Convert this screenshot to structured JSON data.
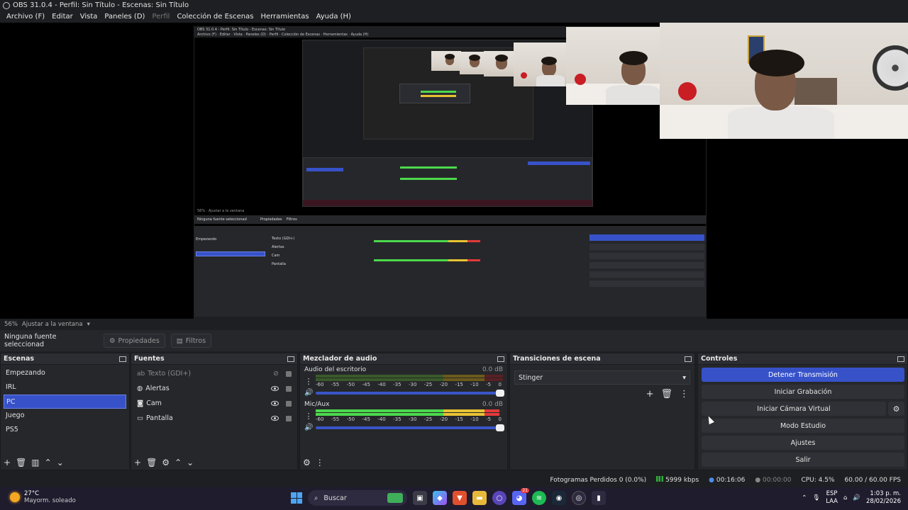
{
  "window": {
    "title": "OBS 31.0.4 - Perfil: Sin Título - Escenas: Sin Título"
  },
  "menu": {
    "items": [
      "Archivo (F)",
      "Editar",
      "Vista",
      "Paneles (D)",
      "Perfil",
      "Colección de Escenas",
      "Herramientas",
      "Ayuda (H)"
    ],
    "disabled_index": 4
  },
  "preview": {
    "zoom_label": "56%",
    "fit_label": "Ajustar a la ventana",
    "nested_title": "OBS 31.0.4 - Perfil: Sin Título - Escenas: Sin Título"
  },
  "source_bar": {
    "no_selection": "Ninguna fuente seleccionad",
    "properties": "Propiedades",
    "filters": "Filtros"
  },
  "scenes": {
    "title": "Escenas",
    "items": [
      "Empezando",
      "IRL",
      "PC",
      "Juego",
      "PS5"
    ],
    "selected_index": 2
  },
  "sources": {
    "title": "Fuentes",
    "items": [
      {
        "name": "Texto (GDI+)",
        "icon": "text-icon",
        "visible": false
      },
      {
        "name": "Alertas",
        "icon": "browser-icon",
        "visible": true
      },
      {
        "name": "Cam",
        "icon": "camera-icon",
        "visible": true
      },
      {
        "name": "Pantalla",
        "icon": "monitor-icon",
        "visible": true
      }
    ]
  },
  "mixer": {
    "title": "Mezclador de audio",
    "channels": [
      {
        "name": "Audio del escritorio",
        "db": "0.0 dB",
        "level": 0.0
      },
      {
        "name": "Mic/Aux",
        "db": "0.0 dB",
        "level": 0.99
      }
    ],
    "ticks": [
      "-60",
      "-55",
      "-50",
      "-45",
      "-40",
      "-35",
      "-30",
      "-25",
      "-20",
      "-15",
      "-10",
      "-5",
      "0"
    ]
  },
  "transitions": {
    "title": "Transiciones de escena",
    "selected": "Stinger"
  },
  "controls": {
    "title": "Controles",
    "stop_stream": "Detener Transmisión",
    "start_recording": "Iniciar Grabación",
    "start_virtual_cam": "Iniciar Cámara Virtual",
    "studio_mode": "Modo Estudio",
    "settings": "Ajustes",
    "exit": "Salir"
  },
  "status": {
    "dropped_frames": "Fotogramas Perdidos 0 (0.0%)",
    "bitrate": "5999 kbps",
    "stream_time": "00:16:06",
    "rec_time": "00:00:00",
    "cpu": "CPU: 4.5%",
    "fps": "60.00 / 60.00 FPS"
  },
  "taskbar": {
    "temperature": "27°C",
    "weather": "Mayorm. soleado",
    "search": "Buscar",
    "lang": "ESP",
    "layout": "LAA",
    "time": "1:03 p. m.",
    "date": "28/02/2026",
    "badge": "21"
  },
  "colors": {
    "accent": "#3752c9",
    "meter_green": "#4cd94c",
    "meter_yellow": "#e8c332",
    "meter_red": "#e23a3a"
  }
}
